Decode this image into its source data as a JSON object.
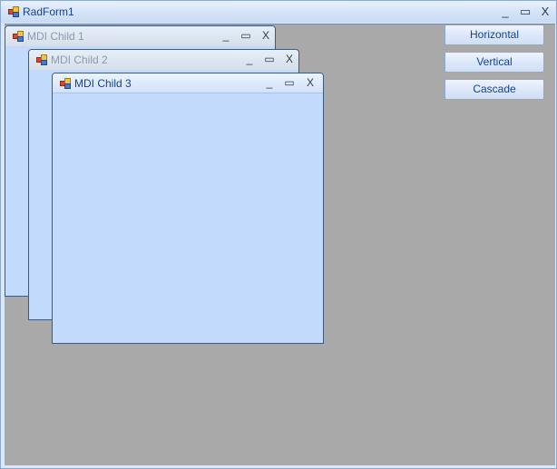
{
  "window": {
    "title": "RadForm1",
    "icon": "app-form-icon",
    "controls": {
      "minimize": "_",
      "maximize": "▭",
      "close": "X"
    }
  },
  "children": [
    {
      "title": "MDI Child 1",
      "state": "inactive"
    },
    {
      "title": "MDI Child 2",
      "state": "inactive"
    },
    {
      "title": "MDI Child 3",
      "state": "active"
    }
  ],
  "child_controls": {
    "minimize": "_",
    "maximize": "▭",
    "close": "X"
  },
  "actions": {
    "horizontal": "Horizontal",
    "vertical": "Vertical",
    "cascade": "Cascade"
  },
  "colors": {
    "mdi_background": "#a9a9a9",
    "child_body": "#c2dbfd",
    "title_text": "#15428b"
  }
}
